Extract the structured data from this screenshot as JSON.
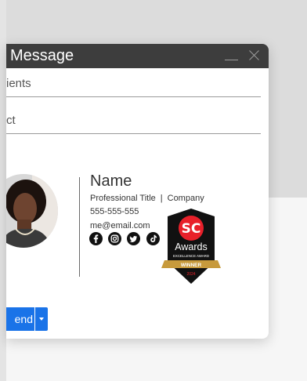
{
  "window": {
    "title": "Message",
    "minimize_icon": "minimize-icon",
    "close_icon": "close-icon"
  },
  "compose": {
    "recipients_label": "ients",
    "subject_label": "ct"
  },
  "signature": {
    "name": "Name",
    "title": "Professional Title",
    "separator": "|",
    "company": "Company",
    "phone": "555-555-555",
    "email": "me@email.com",
    "social_icons": [
      "facebook-icon",
      "instagram-icon",
      "twitter-icon",
      "tiktok-icon"
    ]
  },
  "badge": {
    "logo": "SC",
    "title": "Awards",
    "subtitle": "EXCELLENCE AWARD",
    "ribbon": "WINNER",
    "year": "2024",
    "colors": {
      "red": "#e8202a",
      "dark": "#111111",
      "gold": "#c79a3c"
    }
  },
  "actions": {
    "send_label": "end",
    "dropdown_icon": "caret-down-icon"
  },
  "colors": {
    "titlebar": "#3d3d3d",
    "accent": "#1a73e8"
  }
}
